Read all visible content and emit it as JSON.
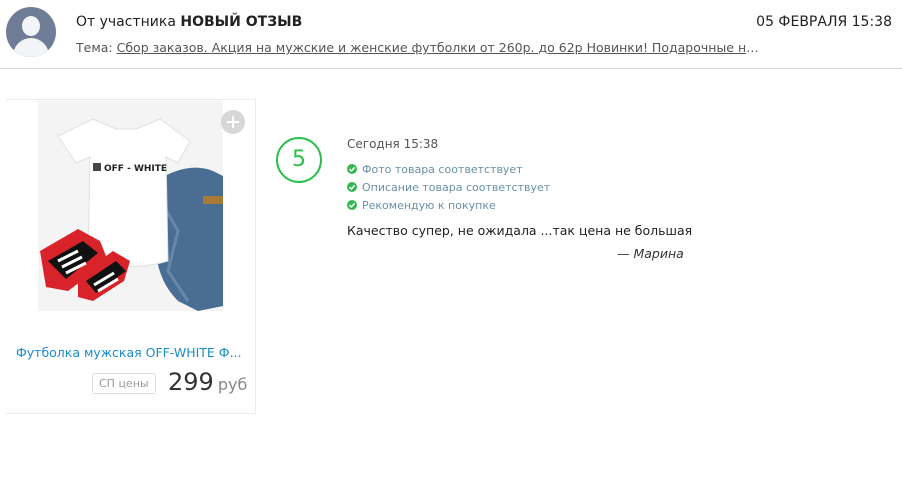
{
  "header": {
    "from_prefix": "От участника",
    "from_event": "НОВЫЙ ОТЗЫВ",
    "date": "05 ФЕВРАЛЯ 15:38",
    "topic_label": "Тема: ",
    "topic_link": "Сбор заказов. Акция на мужские и женские футболки от 260р. до 62р Новинки! Подарочные наборы..."
  },
  "product": {
    "image_text": "OFF - WHITE",
    "title": "Футболка мужская OFF-WHITE Ф...",
    "badge": "СП цены",
    "price": "299",
    "currency": "руб",
    "add_icon": "plus-circle-icon"
  },
  "review": {
    "rating": "5",
    "date": "Сегодня 15:38",
    "checks": [
      "Фото товара соответствует",
      "Описание товара соответствует",
      "Рекомендую к покупке"
    ],
    "text": "Качество супер, не ожидала ...так цена не большая",
    "author": "— Марина"
  },
  "colors": {
    "accent_green": "#2bbf4b",
    "link_blue": "#1a8cc9"
  }
}
